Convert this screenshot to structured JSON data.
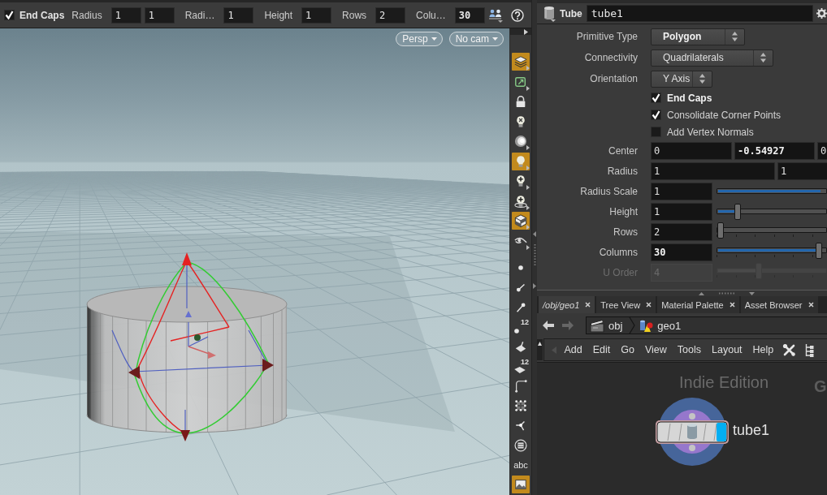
{
  "toolbar": {
    "toggle": {
      "label": "End Caps",
      "checked": true,
      "modified": true
    },
    "params": [
      {
        "label": "Radius",
        "values": [
          {
            "text": "1",
            "modified": false
          },
          {
            "text": "1",
            "modified": false
          }
        ]
      },
      {
        "label": "Radi…",
        "values": [
          {
            "text": "1",
            "modified": false
          }
        ]
      },
      {
        "label": "Height",
        "values": [
          {
            "text": "1",
            "modified": false
          }
        ]
      },
      {
        "label": "Rows",
        "values": [
          {
            "text": "2",
            "modified": false
          }
        ]
      },
      {
        "label": "Colu…",
        "values": [
          {
            "text": "30",
            "modified": true
          }
        ]
      }
    ]
  },
  "viewport": {
    "view_menus": [
      "Persp",
      "No cam"
    ]
  },
  "display_tools": [
    {
      "kind": "layers",
      "on": true,
      "submenu": true
    },
    {
      "kind": "frame",
      "on": false,
      "submenu": true
    },
    {
      "kind": "lock",
      "on": false,
      "submenu": false
    },
    {
      "kind": "bulboff",
      "on": false,
      "submenu": false
    },
    {
      "kind": "sphere",
      "on": false,
      "submenu": true
    },
    {
      "kind": "bulb",
      "on": true,
      "submenu": true
    },
    {
      "kind": "bulbadd",
      "on": false,
      "submenu": true
    },
    {
      "kind": "bulbring",
      "on": false,
      "submenu": true
    },
    {
      "kind": "cube",
      "on": true,
      "submenu": true
    },
    {
      "kind": "glasses",
      "on": false,
      "submenu": true
    }
  ],
  "marker_tools": [
    {
      "kind": "point",
      "on": false
    },
    {
      "kind": "normal",
      "on": false
    },
    {
      "kind": "pin",
      "on": false
    },
    {
      "kind": "pointnum",
      "label": "12",
      "on": false
    },
    {
      "kind": "face",
      "on": false
    },
    {
      "kind": "facenum",
      "label": "12",
      "on": false
    },
    {
      "kind": "corner",
      "on": false
    },
    {
      "kind": "grid",
      "on": false
    },
    {
      "kind": "vertex",
      "on": false
    },
    {
      "kind": "backface",
      "on": false
    },
    {
      "kind": "text",
      "label": "abc",
      "on": false
    },
    {
      "kind": "image",
      "on": true
    }
  ],
  "parameters": {
    "node_type": "Tube",
    "node_name": "tube1",
    "rows": [
      {
        "kind": "menu",
        "label": "Primitive Type",
        "value": "Polygon",
        "modified": true
      },
      {
        "kind": "menu",
        "label": "Connectivity",
        "value": "Quadrilaterals",
        "modified": false
      },
      {
        "kind": "menu",
        "label": "Orientation",
        "value": "Y Axis",
        "modified": false
      },
      {
        "kind": "toggle",
        "label": "End Caps",
        "checked": true,
        "modified": true
      },
      {
        "kind": "toggle",
        "label": "Consolidate Corner Points",
        "checked": true,
        "modified": false
      },
      {
        "kind": "toggle",
        "label": "Add Vertex Normals",
        "checked": false,
        "modified": false
      },
      {
        "kind": "vector",
        "label": "Center",
        "values": [
          {
            "text": "0",
            "modified": false
          },
          {
            "text": "-0.54927",
            "modified": true
          },
          {
            "text": "0",
            "modified": false
          }
        ]
      },
      {
        "kind": "vector",
        "label": "Radius",
        "values": [
          {
            "text": "1",
            "modified": false
          },
          {
            "text": "1",
            "modified": false
          }
        ]
      },
      {
        "kind": "slider",
        "label": "Radius Scale",
        "value": "1",
        "level": 1,
        "modified": false,
        "disabled": false
      },
      {
        "kind": "slider",
        "label": "Height",
        "value": "1",
        "level": 0.17,
        "modified": false,
        "disabled": false
      },
      {
        "kind": "intslider",
        "label": "Rows",
        "value": "2",
        "level": 0,
        "modified": false,
        "disabled": false
      },
      {
        "kind": "intslider",
        "label": "Columns",
        "value": "30",
        "level": 0.96,
        "modified": true,
        "disabled": false
      },
      {
        "kind": "intslider",
        "label": "U Order",
        "value": "4",
        "level": 0.37,
        "modified": false,
        "disabled": true
      }
    ]
  },
  "network": {
    "tabs": [
      {
        "kind": "network",
        "label": "/obj/geo1",
        "selected": true
      },
      {
        "kind": "pane",
        "label": "Tree View",
        "selected": false
      },
      {
        "kind": "pane",
        "label": "Material Palette",
        "selected": false
      },
      {
        "kind": "pane",
        "label": "Asset Browser",
        "selected": false
      }
    ],
    "nav_buttons": [
      {
        "kind": "back",
        "disabled": false
      },
      {
        "kind": "forward",
        "disabled": true
      }
    ],
    "path": [
      {
        "kind": "obj",
        "label": "obj"
      },
      {
        "kind": "geo",
        "label": "geo1"
      }
    ],
    "menu": [
      "Add",
      "Edit",
      "Go",
      "View",
      "Tools",
      "Layout",
      "Help"
    ],
    "edition_label": "Indie Edition",
    "context_label": "G",
    "nodes": [
      {
        "name": "tube1",
        "selected": true,
        "display_flag": true
      }
    ]
  }
}
